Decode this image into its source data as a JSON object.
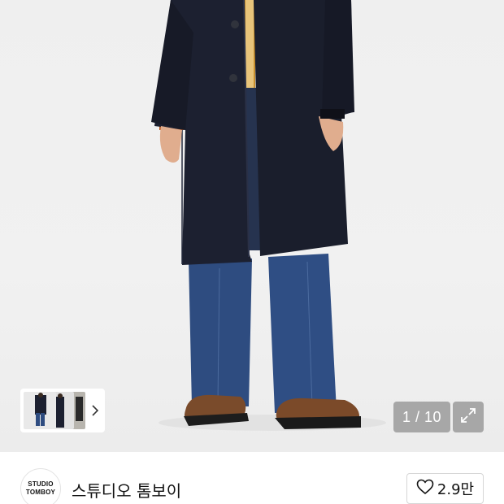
{
  "gallery": {
    "counter": "1 / 10",
    "thumbnails": [
      {
        "alt": "thumbnail-1"
      },
      {
        "alt": "thumbnail-2"
      },
      {
        "alt": "thumbnail-3"
      }
    ],
    "icons": {
      "next": "chevron-right-icon",
      "expand": "expand-icon"
    }
  },
  "brand": {
    "logo_line1": "STUDIO",
    "logo_line2": "TOMBOY",
    "name": "스튜디오 톰보이"
  },
  "like": {
    "icon": "heart-icon",
    "count": "2.9만"
  },
  "colors": {
    "coat": "#1b1f2c",
    "denim": "#2d4a7c",
    "shoe": "#7a4a2a",
    "overlay": "#8c8c8c"
  }
}
